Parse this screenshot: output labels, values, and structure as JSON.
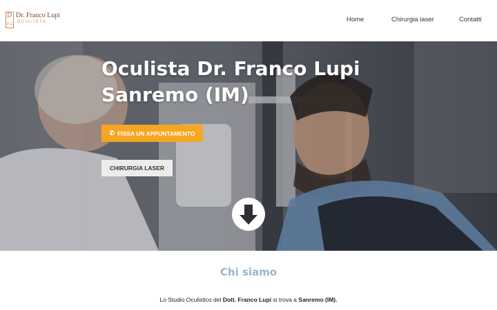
{
  "header": {
    "logo": {
      "mark_top": "D",
      "mark_bottom": "F.L",
      "name": "Dr. Franco Lupi",
      "subtitle": "OCULISTA"
    },
    "nav": [
      {
        "label": "Home"
      },
      {
        "label": "Chirurgia laser"
      },
      {
        "label": "Contatti"
      }
    ]
  },
  "hero": {
    "title_line1": "Oculista Dr. Franco Lupi",
    "title_line2": "Sanremo (IM)",
    "primary_button": {
      "label": "FISSA UN APPUNTAMENTO",
      "icon": "phone-icon"
    },
    "secondary_button": {
      "label": "CHIRURGIA LASER"
    },
    "scroll_icon": "arrow-down-circle-icon"
  },
  "about": {
    "title": "Chi siamo",
    "text_before": "Lo Studio Oculistico del ",
    "text_name": "Dott. Franco Lupi",
    "text_middle": " si trova a ",
    "text_city": "Sanremo (IM).",
    "text_after": ""
  },
  "colors": {
    "accent_orange": "#f5a623",
    "title_blue": "#9bb4cf",
    "logo_brown": "#7a4a35"
  }
}
